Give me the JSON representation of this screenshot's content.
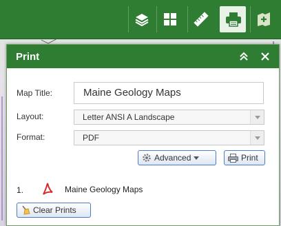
{
  "toolbar": {
    "tools": [
      {
        "icon": "layers-icon"
      },
      {
        "icon": "basemap-gallery-icon"
      },
      {
        "icon": "measure-icon"
      },
      {
        "icon": "print-icon",
        "active": true
      },
      {
        "icon": "add-data-icon"
      }
    ],
    "color": "#2e7d32"
  },
  "panel": {
    "title": "Print",
    "collapse_icon": "chevron-double-up-icon",
    "close_icon": "close-icon"
  },
  "form": {
    "map_title_label": "Map Title:",
    "map_title_value": "Maine Geology Maps",
    "layout_label": "Layout:",
    "layout_value": "Letter ANSI A Landscape",
    "format_label": "Format:",
    "format_value": "PDF"
  },
  "buttons": {
    "advanced_label": "Advanced",
    "print_label": "Print",
    "clear_prints_label": "Clear Prints"
  },
  "results": [
    {
      "number": "1.",
      "title": "Maine Geology Maps",
      "icon": "pdf-icon"
    }
  ]
}
